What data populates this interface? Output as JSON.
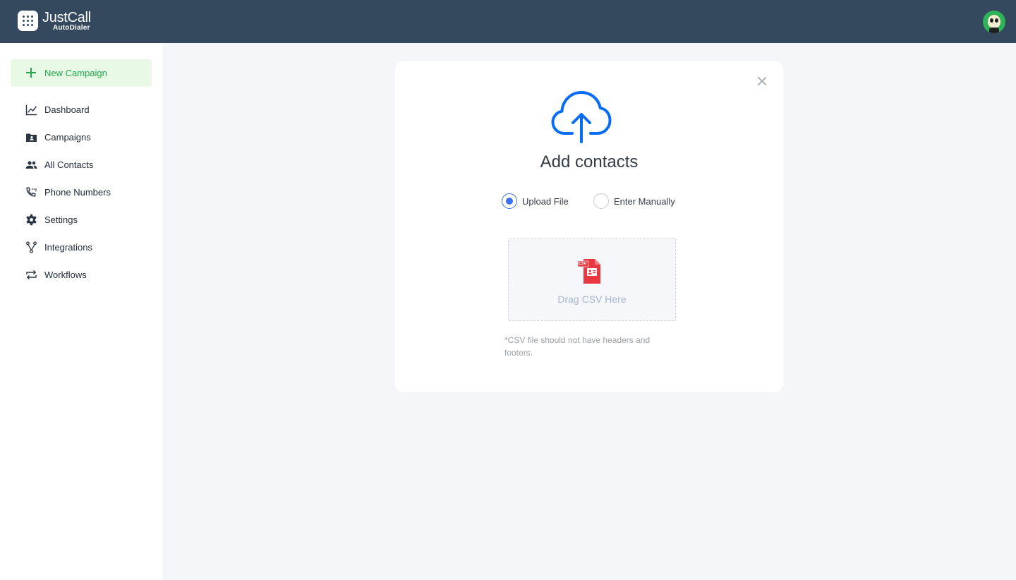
{
  "app": {
    "brand": "JustCall",
    "product": "AutoDialer"
  },
  "header": {
    "avatar_icon": "user-avatar"
  },
  "sidebar": {
    "new_campaign_label": "New Campaign",
    "items": [
      {
        "label": "Dashboard",
        "icon": "line-chart-icon"
      },
      {
        "label": "Campaigns",
        "icon": "folder-contact-icon"
      },
      {
        "label": "All Contacts",
        "icon": "people-icon"
      },
      {
        "label": "Phone Numbers",
        "icon": "phone-dial-icon"
      },
      {
        "label": "Settings",
        "icon": "gear-icon"
      },
      {
        "label": "Integrations",
        "icon": "fork-icon"
      },
      {
        "label": "Workflows",
        "icon": "repeat-icon"
      }
    ]
  },
  "modal": {
    "title": "Add contacts",
    "options": [
      {
        "label": "Upload File",
        "selected": true
      },
      {
        "label": "Enter Manually",
        "selected": false
      }
    ],
    "dropzone_text": "Drag CSV Here",
    "csv_badge": "CSV",
    "note": "*CSV file should not have headers and footers."
  },
  "colors": {
    "header_bg": "#34495e",
    "accent_green": "#1eaa4c",
    "accent_blue": "#0a6cf5",
    "csv_red": "#ea3840",
    "radio_blue": "#3b72f2"
  }
}
